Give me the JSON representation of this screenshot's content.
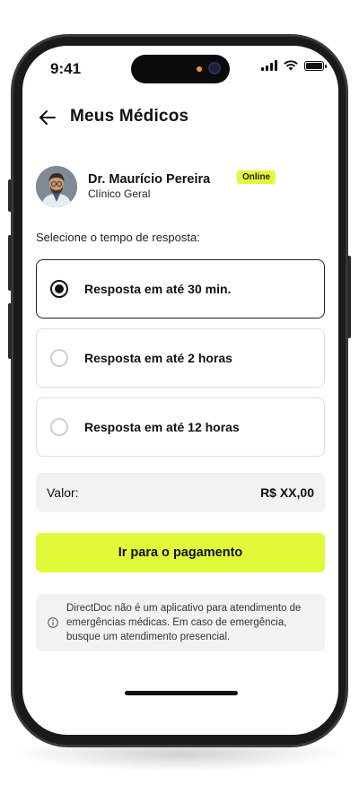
{
  "status_bar": {
    "time": "9:41"
  },
  "header": {
    "title": "Meus Médicos"
  },
  "doctor": {
    "name": "Dr. Maurício Pereira",
    "specialty": "Clínico Geral",
    "status": "Online"
  },
  "selection": {
    "label": "Selecione o tempo de resposta:",
    "options": [
      {
        "label": "Resposta em até 30 min.",
        "selected": true
      },
      {
        "label": "Resposta em até 2 horas",
        "selected": false
      },
      {
        "label": "Resposta em até 12 horas",
        "selected": false
      }
    ]
  },
  "price": {
    "label": "Valor:",
    "value": "R$ XX,00"
  },
  "cta": {
    "label": "Ir para o pagamento"
  },
  "notice": {
    "text": "DirectDoc não é um aplicativo para atendimento de emergências médicas. Em caso de emergência, busque um atendimento presencial."
  },
  "colors": {
    "accent": "#E2F93A",
    "text": "#111111",
    "surface": "#F2F2F2"
  }
}
